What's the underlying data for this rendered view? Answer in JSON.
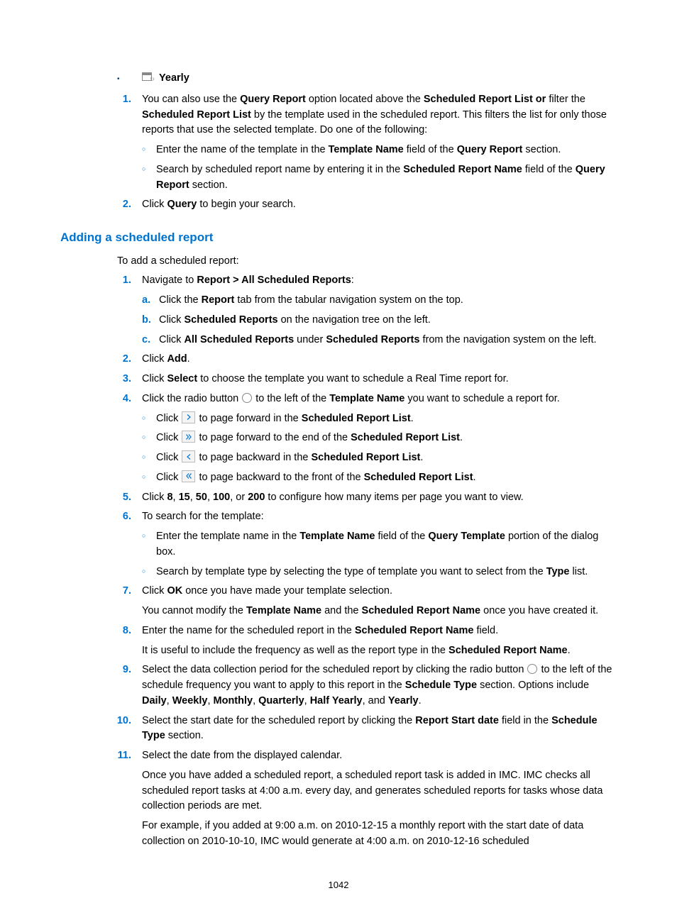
{
  "top_bullet": {
    "label": "Yearly"
  },
  "block1": {
    "step1": {
      "t1": "You can also use the ",
      "b1": "Query Report",
      "t2": " option located above the ",
      "b2": "Scheduled Report List or ",
      "t3": "filter the ",
      "b3": "Scheduled Report List",
      "t4": " by the template used in the scheduled report. This filters the list for only those reports that use the selected template. Do one of the following:",
      "sub1": {
        "t1": "Enter the name of the template in the ",
        "b1": "Template Name",
        "t2": " field of the ",
        "b2": "Query Report",
        "t3": " section."
      },
      "sub2": {
        "t1": "Search by scheduled report name by entering it in the ",
        "b1": "Scheduled Report Name",
        "t2": " field of the ",
        "b2": "Query Report",
        "t3": " section."
      }
    },
    "step2": {
      "t1": "Click ",
      "b1": "Query",
      "t2": " to begin your search."
    }
  },
  "heading": "Adding a scheduled report",
  "intro": "To add a scheduled report:",
  "block2": {
    "step1": {
      "t1": "Navigate to ",
      "b1": "Report > All Scheduled Reports",
      "t2": ":",
      "a": {
        "t1": "Click the ",
        "b1": "Report",
        "t2": " tab from the tabular navigation system on the top."
      },
      "b": {
        "t1": "Click ",
        "b1": "Scheduled Reports",
        "t2": " on the navigation tree on the left."
      },
      "c": {
        "t1": "Click ",
        "b1": "All Scheduled Reports",
        "t2": " under ",
        "b2": "Scheduled Reports",
        "t3": " from the navigation system on the left."
      }
    },
    "step2": {
      "t1": "Click ",
      "b1": "Add",
      "t2": "."
    },
    "step3": {
      "t1": "Click ",
      "b1": "Select",
      "t2": " to choose the template you want to schedule a Real Time report for."
    },
    "step4": {
      "t1": "Click the radio button ",
      "t2": " to the left of the ",
      "b1": "Template Name",
      "t3": " you want to schedule a report for.",
      "sub1": {
        "t1": "Click ",
        "t2": " to page forward in the ",
        "b1": "Scheduled Report List",
        "t3": "."
      },
      "sub2": {
        "t1": "Click ",
        "t2": " to page forward to the end of the ",
        "b1": "Scheduled Report List",
        "t3": "."
      },
      "sub3": {
        "t1": "Click ",
        "t2": " to page backward in the ",
        "b1": "Scheduled Report List",
        "t3": "."
      },
      "sub4": {
        "t1": "Click ",
        "t2": " to page backward to the front of the ",
        "b1": "Scheduled Report List",
        "t3": "."
      }
    },
    "step5": {
      "t1": "Click ",
      "b1": "8",
      "t2": ", ",
      "b2": "15",
      "t3": ", ",
      "b3": "50",
      "t4": ", ",
      "b4": "100",
      "t5": ", or ",
      "b5": "200",
      "t6": " to configure how many items per page you want to view."
    },
    "step6": {
      "t1": "To search for the template:",
      "sub1": {
        "t1": "Enter the template name in the ",
        "b1": "Template Name",
        "t2": " field of the ",
        "b2": "Query Template",
        "t3": " portion of the dialog box."
      },
      "sub2": {
        "t1": "Search by template type by selecting the type of template you want to select from the ",
        "b1": "Type",
        "t2": " list."
      }
    },
    "step7": {
      "t1": "Click ",
      "b1": "OK",
      "t2": " once you have made your template selection.",
      "f1a": "You cannot modify the ",
      "f1b": "Template Name",
      "f1c": " and the ",
      "f1d": "Scheduled Report Name",
      "f1e": " once you have created it."
    },
    "step8": {
      "t1": "Enter the name for the scheduled report in the ",
      "b1": "Scheduled Report Name",
      "t2": " field.",
      "f1a": "It is useful to include the frequency as well as the report type in the ",
      "f1b": "Scheduled Report Name",
      "f1c": "."
    },
    "step9": {
      "t1": "Select the data collection period for the scheduled report by clicking the radio button ",
      "t2": " to the left of the schedule frequency you want to apply to this report in the ",
      "b1": "Schedule Type",
      "t3": " section. Options include ",
      "b2": "Daily",
      "c1": ", ",
      "b3": "Weekly",
      "c2": ", ",
      "b4": "Monthly",
      "c3": ", ",
      "b5": "Quarterly",
      "c4": ", ",
      "b6": "Half Yearly",
      "c5": ", and ",
      "b7": "Yearly",
      "c6": "."
    },
    "step10": {
      "t1": "Select the start date for the scheduled report by clicking the ",
      "b1": "Report Start date",
      "t2": " field in the ",
      "b2": "Schedule Type",
      "t3": " section."
    },
    "step11": {
      "t1": "Select the date from the displayed calendar.",
      "f1": "Once you have added a scheduled report, a scheduled report task is added in IMC. IMC checks all scheduled report tasks at 4:00 a.m. every day, and generates scheduled reports for tasks whose data collection periods are met.",
      "f2": "For example, if you added at 9:00 a.m. on 2010-12-15 a monthly report with the start date of data collection on 2010-10-10, IMC would generate at 4:00 a.m. on 2010-12-16 scheduled"
    }
  },
  "pagenum": "1042"
}
